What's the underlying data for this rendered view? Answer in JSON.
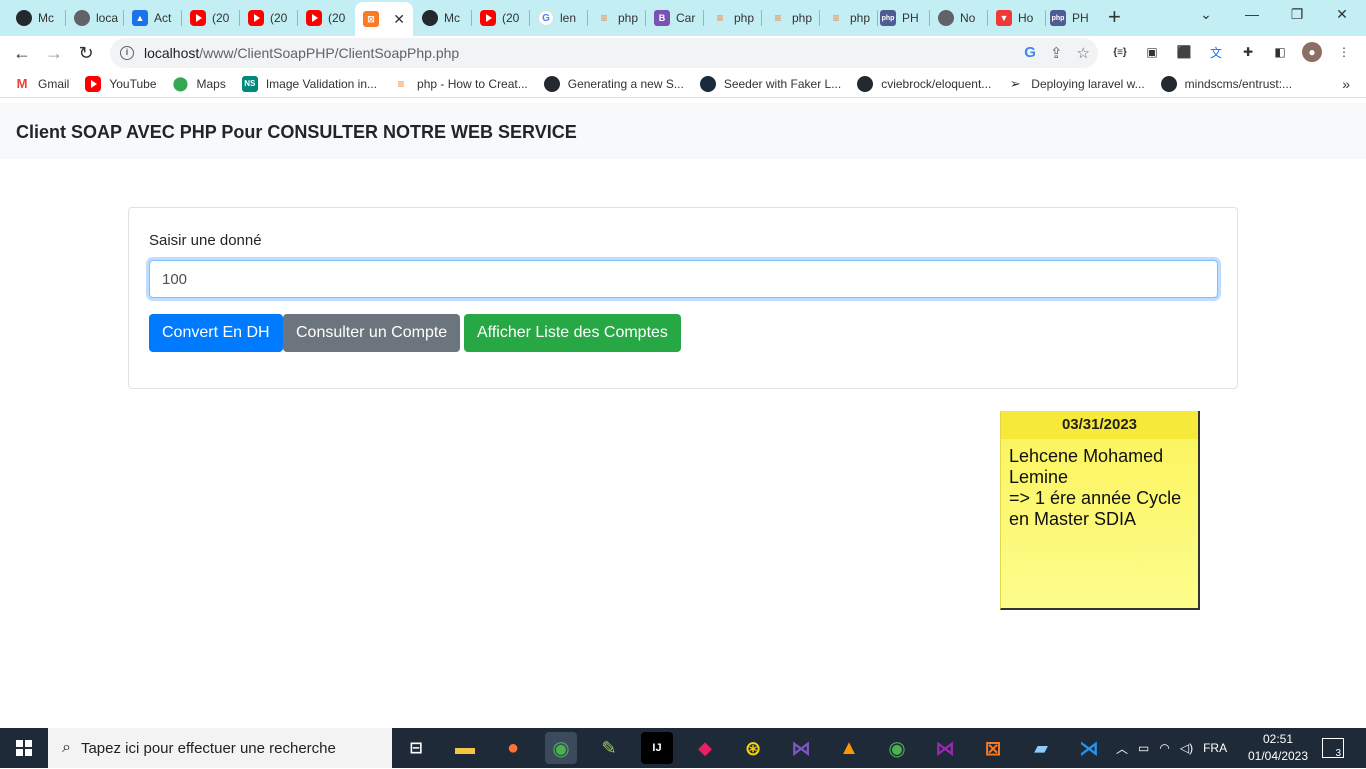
{
  "browser": {
    "tabs": [
      {
        "label": "Mc",
        "icon": "github-icon"
      },
      {
        "label": "loca",
        "icon": "globe-icon"
      },
      {
        "label": "Act",
        "icon": "contacts-icon"
      },
      {
        "label": "(20",
        "icon": "youtube-icon"
      },
      {
        "label": "(20",
        "icon": "youtube-icon"
      },
      {
        "label": "(20",
        "icon": "youtube-icon"
      },
      {
        "label": "",
        "icon": "xampp-icon",
        "active": true
      },
      {
        "label": "Mc",
        "icon": "github-icon"
      },
      {
        "label": "(20",
        "icon": "youtube-icon"
      },
      {
        "label": "len",
        "icon": "google-icon"
      },
      {
        "label": "php",
        "icon": "stackoverflow-icon"
      },
      {
        "label": "Car",
        "icon": "bootstrap-icon"
      },
      {
        "label": "php",
        "icon": "stackoverflow-icon"
      },
      {
        "label": "php",
        "icon": "stackoverflow-icon"
      },
      {
        "label": "php",
        "icon": "stackoverflow-icon"
      },
      {
        "label": "PH",
        "icon": "php-icon"
      },
      {
        "label": "No",
        "icon": "chrome-icon"
      },
      {
        "label": "Ho",
        "icon": "vivaldi-icon"
      },
      {
        "label": "PH",
        "icon": "php-icon"
      }
    ],
    "url_host": "localhost",
    "url_path": "/www/ClientSoapPHP/ClientSoapPhp.php",
    "bookmarks": [
      {
        "label": "Gmail",
        "icon": "gmail-icon"
      },
      {
        "label": "YouTube",
        "icon": "youtube-icon"
      },
      {
        "label": "Maps",
        "icon": "maps-icon"
      },
      {
        "label": "Image Validation in...",
        "icon": "ns-icon"
      },
      {
        "label": "php - How to Creat...",
        "icon": "stackoverflow-icon"
      },
      {
        "label": "Generating a new S...",
        "icon": "github-icon"
      },
      {
        "label": "Seeder with Faker L...",
        "icon": "laracasts-icon"
      },
      {
        "label": "cviebrock/eloquent...",
        "icon": "github-icon"
      },
      {
        "label": "Deploying laravel w...",
        "icon": "send-icon"
      },
      {
        "label": "mindscms/entrust:...",
        "icon": "github-icon"
      }
    ]
  },
  "page": {
    "title": "Client SOAP AVEC PHP Pour CONSULTER NOTRE WEB SERVICE",
    "form": {
      "label": "Saisir une donné",
      "value": "100",
      "buttons": {
        "convert": "Convert En DH",
        "consult": "Consulter un Compte",
        "list": "Afficher Liste des Comptes"
      }
    }
  },
  "sticky_note": {
    "date": "03/31/2023",
    "line1": "Lehcene Mohamed",
    "line2": "Lemine",
    "line3": "=> 1 ére année Cycle",
    "line4": "en Master SDIA"
  },
  "taskbar": {
    "search_placeholder": "Tapez ici pour effectuer une recherche",
    "language": "FRA",
    "time": "02:51",
    "date": "01/04/2023",
    "notification_count": "3"
  },
  "colors": {
    "primary": "#007bff",
    "secondary": "#6c757d",
    "success": "#28a745",
    "tabstrip": "#c3eef4",
    "sticky": "#fbf35a"
  }
}
